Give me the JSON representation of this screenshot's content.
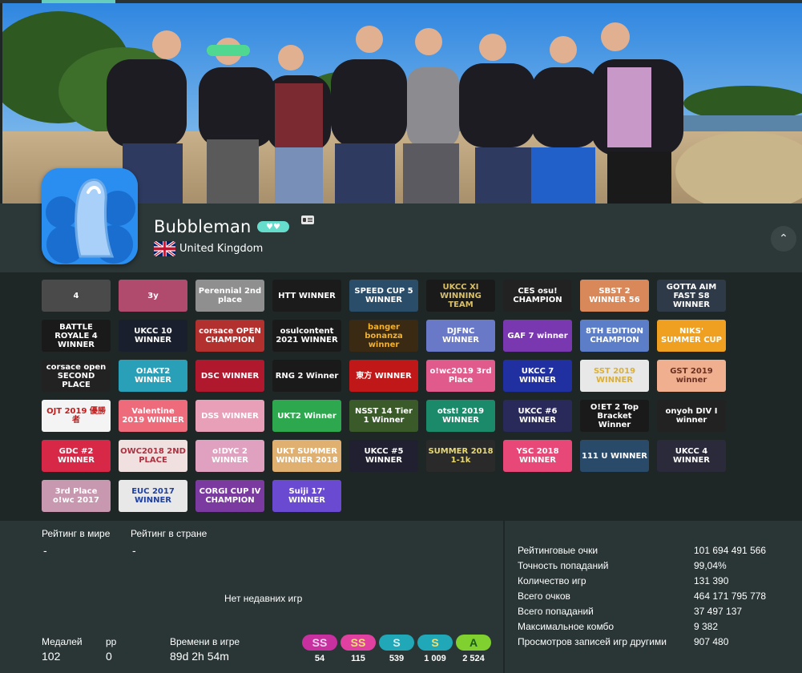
{
  "profile": {
    "username": "Bubbleman",
    "supporter_icon": "hearts-icon",
    "country": "United Kingdom",
    "flag_icon": "uk-flag-icon",
    "collapse_icon": "chevron-up-icon",
    "colors": {
      "accent": "#66ccbb",
      "supporter": "#66ddcc",
      "background": "#1e2626",
      "panel": "#2a3535"
    }
  },
  "badges": [
    {
      "text": "4",
      "bg": "#4a4a4a",
      "fg": "#ffffff"
    },
    {
      "text": "3y",
      "bg": "#b04b6d",
      "fg": "#ffffff"
    },
    {
      "text": "Perennial 2nd place",
      "bg": "#8f8f8f",
      "fg": "#ffffff"
    },
    {
      "text": "HTT WINNER",
      "bg": "#1b1b1b",
      "fg": "#ffffff"
    },
    {
      "text": "SPEED CUP 5 WINNER",
      "bg": "#2a4d6a",
      "fg": "#ffffff"
    },
    {
      "text": "UKCC XI WINNING TEAM",
      "bg": "#1a1a1a",
      "fg": "#d8c06a"
    },
    {
      "text": "CES osu! CHAMPION",
      "bg": "#222222",
      "fg": "#ffffff"
    },
    {
      "text": "SBST 2 WINNER 56",
      "bg": "#d9885a",
      "fg": "#ffffff"
    },
    {
      "text": "GOTTA AIM FAST S8 WINNER",
      "bg": "#2f3a48",
      "fg": "#ffffff"
    },
    {
      "text": "BATTLE ROYALE 4 WINNER",
      "bg": "#1a1a1a",
      "fg": "#ffffff"
    },
    {
      "text": "UKCC 10 WINNER",
      "bg": "#1a1f2e",
      "fg": "#ffffff"
    },
    {
      "text": "corsace OPEN CHAMPION",
      "bg": "#b2302e",
      "fg": "#ffffff"
    },
    {
      "text": "osulcontent 2021 WINNER",
      "bg": "#1a1a1a",
      "fg": "#ffffff"
    },
    {
      "text": "banger bonanza winner",
      "bg": "#3a2a14",
      "fg": "#f3b12c"
    },
    {
      "text": "DJFNC WINNER",
      "bg": "#6a78c8",
      "fg": "#ffffff"
    },
    {
      "text": "GAF 7 winner",
      "bg": "#7a38b0",
      "fg": "#ffffff"
    },
    {
      "text": "8TH EDITION CHAMPION",
      "bg": "#5c7ec8",
      "fg": "#ffffff"
    },
    {
      "text": "NIKS' SUMMER CUP",
      "bg": "#f0a020",
      "fg": "#ffffff"
    },
    {
      "text": "corsace open SECOND PLACE",
      "bg": "#222222",
      "fg": "#ffffff"
    },
    {
      "text": "O!AKT2 WINNER",
      "bg": "#2aa0b8",
      "fg": "#ffffff"
    },
    {
      "text": "DSC WINNER",
      "bg": "#b0182e",
      "fg": "#ffffff"
    },
    {
      "text": "RNG 2 Winner",
      "bg": "#1a1a1a",
      "fg": "#ffffff"
    },
    {
      "text": "東方 WINNER",
      "bg": "#c01818",
      "fg": "#ffffff"
    },
    {
      "text": "o!wc2019 3rd Place",
      "bg": "#e05a8c",
      "fg": "#ffffff"
    },
    {
      "text": "UKCC 7 WINNER",
      "bg": "#2030a0",
      "fg": "#ffffff"
    },
    {
      "text": "SST 2019 WINNER",
      "bg": "#e8e8e8",
      "fg": "#d8b040"
    },
    {
      "text": "GST 2019 winner",
      "bg": "#f0b090",
      "fg": "#6a3020"
    },
    {
      "text": "OJT 2019 優勝者",
      "bg": "#f4f4f4",
      "fg": "#c02020"
    },
    {
      "text": "Valentine 2019 WINNER",
      "bg": "#ee6b7b",
      "fg": "#ffffff"
    },
    {
      "text": "DSS WINNER",
      "bg": "#e8a0b8",
      "fg": "#ffffff"
    },
    {
      "text": "UKT2 Winner",
      "bg": "#2ea84e",
      "fg": "#ffffff"
    },
    {
      "text": "NSST 14 Tier 1 Winner",
      "bg": "#3a5a2a",
      "fg": "#ffffff"
    },
    {
      "text": "otst! 2019 WINNER",
      "bg": "#1a8a6a",
      "fg": "#ffffff"
    },
    {
      "text": "UKCC #6 WINNER",
      "bg": "#2a2a5a",
      "fg": "#ffffff"
    },
    {
      "text": "O!ET 2 Top Bracket Winner",
      "bg": "#1a1a1a",
      "fg": "#ffffff"
    },
    {
      "text": "onyoh DIV I winner",
      "bg": "#222222",
      "fg": "#ffffff"
    },
    {
      "text": "GDC #2 WINNER",
      "bg": "#d82848",
      "fg": "#ffffff"
    },
    {
      "text": "OWC2018 2ND PLACE",
      "bg": "#f0e0e0",
      "fg": "#b03040"
    },
    {
      "text": "o!DYC 2 WINNER",
      "bg": "#e0a0c0",
      "fg": "#ffffff"
    },
    {
      "text": "UKT SUMMER WINNER 2018",
      "bg": "#e0b070",
      "fg": "#ffffff"
    },
    {
      "text": "UKCC #5 WINNER",
      "bg": "#202030",
      "fg": "#ffffff"
    },
    {
      "text": "SUMMER 2018 1-1k",
      "bg": "#2a2a2a",
      "fg": "#e8d870"
    },
    {
      "text": "YSC 2018 WINNER",
      "bg": "#e84878",
      "fg": "#ffffff"
    },
    {
      "text": "111 U WINNER",
      "bg": "#2a4a6a",
      "fg": "#ffffff"
    },
    {
      "text": "UKCC 4 WINNER",
      "bg": "#2a2a3a",
      "fg": "#ffffff"
    },
    {
      "text": "3rd Place o!wc 2017",
      "bg": "#c898b0",
      "fg": "#ffffff"
    },
    {
      "text": "EUC 2017 WINNER",
      "bg": "#e8e8e8",
      "fg": "#2040a0"
    },
    {
      "text": "CORGI CUP IV CHAMPION",
      "bg": "#7a3aa0",
      "fg": "#ffffff"
    },
    {
      "text": "Suiji 17' WINNER",
      "bg": "#6a4ad0",
      "fg": "#ffffff"
    }
  ],
  "ranks": {
    "global_label": "Рейтинг в мире",
    "global_value": "-",
    "country_label": "Рейтинг в стране",
    "country_value": "-",
    "no_recent": "Нет недавних игр"
  },
  "summary": {
    "medals_label": "Медалей",
    "medals_value": "102",
    "pp_label": "pp",
    "pp_value": "0",
    "playtime_label": "Времени в игре",
    "playtime_value": "89d 2h 54m"
  },
  "grades": [
    {
      "label": "SS",
      "count": "54",
      "bg": "#c830a0",
      "fg": "#f0d0f0"
    },
    {
      "label": "SS",
      "count": "115",
      "bg": "#e040a0",
      "fg": "#f0e070"
    },
    {
      "label": "S",
      "count": "539",
      "bg": "#20a8b8",
      "fg": "#d0f0f0"
    },
    {
      "label": "S",
      "count": "1 009",
      "bg": "#20a8b8",
      "fg": "#f0e070"
    },
    {
      "label": "A",
      "count": "2 524",
      "bg": "#80d030",
      "fg": "#1a5a1a"
    }
  ],
  "ranked_stats": [
    {
      "label": "Рейтинговые очки",
      "value": "101 694 491 566"
    },
    {
      "label": "Точность попаданий",
      "value": "99,04%"
    },
    {
      "label": "Количество игр",
      "value": "131 390"
    },
    {
      "label": "Всего очков",
      "value": "464 171 795 778"
    },
    {
      "label": "Всего попаданий",
      "value": "37 497 137"
    },
    {
      "label": "Максимальное комбо",
      "value": "9 382"
    },
    {
      "label": "Просмотров записей игр другими",
      "value": "907 480"
    }
  ]
}
